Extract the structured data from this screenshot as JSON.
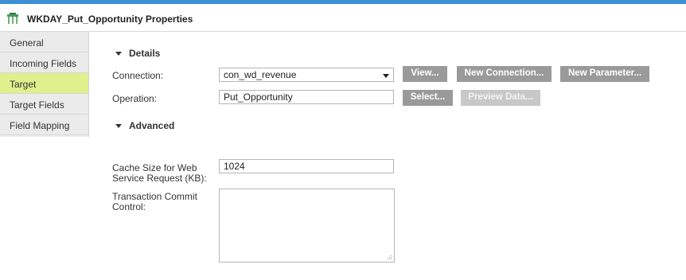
{
  "window": {
    "title": "WKDAY_Put_Opportunity Properties"
  },
  "sidebar": {
    "items": [
      {
        "label": "General",
        "active": false
      },
      {
        "label": "Incoming Fields",
        "active": false
      },
      {
        "label": "Target",
        "active": true
      },
      {
        "label": "Target Fields",
        "active": false
      },
      {
        "label": "Field Mapping",
        "active": false
      }
    ]
  },
  "details": {
    "heading": "Details",
    "connection_label": "Connection:",
    "connection_value": "con_wd_revenue",
    "operation_label": "Operation:",
    "operation_value": "Put_Opportunity",
    "view_button": "View...",
    "new_connection_button": "New Connection...",
    "new_parameter_button": "New Parameter...",
    "select_button": "Select...",
    "preview_button": "Preview Data..."
  },
  "advanced": {
    "heading": "Advanced",
    "cache_label_line1": "Cache Size for Web",
    "cache_label_line2": "Service Request (KB):",
    "cache_value": "1024",
    "commit_label_line1": "Transaction Commit",
    "commit_label_line2": "Control:",
    "commit_value": ""
  },
  "colors": {
    "accent_bar": "#3d8fd6",
    "active_tab": "#dff08c",
    "button": "#9a9a9a",
    "button_disabled": "#c8c8c8"
  },
  "icons": {
    "header": "target-table-icon",
    "toggle": "triangle-down-icon",
    "dropdown": "chevron-down-icon"
  }
}
